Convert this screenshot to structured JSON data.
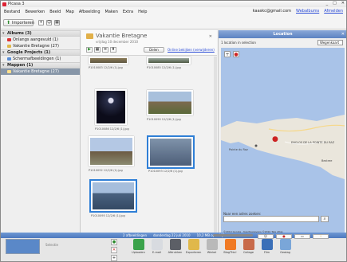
{
  "window": {
    "title": "Picasa 3",
    "controls": [
      "_",
      "□",
      "✕"
    ]
  },
  "menu": [
    "Bestand",
    "Bewerken",
    "Beeld",
    "Map",
    "Afbeelding",
    "Maken",
    "Extra",
    "Help"
  ],
  "user": {
    "email": "kaaskc@gmail.com",
    "links": [
      "Webalbums",
      "Afmelden"
    ]
  },
  "toolbar": {
    "import_label": "Importeren",
    "filter_label": "Filters"
  },
  "search": {
    "placeholder": ""
  },
  "sidebar": {
    "groups": [
      {
        "label": "Albums (3)",
        "items": [
          "Onlangs aangevuld (1)",
          "Vakantie Bretagne (27)"
        ]
      },
      {
        "label": "Google Projects (1)",
        "items": [
          "Schermafbeeldingen (1)"
        ]
      },
      {
        "label": "Mappen (1)",
        "items": [
          "Vakantie Bretagne (27)"
        ]
      }
    ]
  },
  "album": {
    "title": "Vakantie Bretagne",
    "subtitle": "vrijdag 10 december 2010",
    "share_label": "Delen",
    "link_label": "Online bekijken (verwijderen)"
  },
  "thumbs": [
    {
      "caption": "P1010083 12/2/6 (1).jpg",
      "colors": [
        "#8a7a56",
        "#5f5843"
      ]
    },
    {
      "caption": "P1010085 12/2/6 (1).jpg",
      "colors": [
        "#9aa89c",
        "#4f5a44"
      ]
    },
    {
      "caption": "P1010086 12/2/6 (1).jpg",
      "colors": [
        "#0c0c1a",
        "#4a5a8a"
      ]
    },
    {
      "caption": "P1010090 12/2/6 (1).jpg",
      "colors": [
        "#a8c0dc",
        "#7d6a50"
      ]
    },
    {
      "caption": "P1010092 12/2/6 (1).jpg",
      "colors": [
        "#b4c8e4",
        "#6b5a42"
      ]
    },
    {
      "caption": "P1010093 12/2/6 (1).jpg",
      "colors": [
        "#7f93aa",
        "#4d5e78"
      ]
    },
    {
      "caption": "P1010095 12/2/6 (1).jpg",
      "colors": [
        "#a6bedc",
        "#4a6280"
      ]
    }
  ],
  "location": {
    "title": "Location",
    "located_text": "1 location in selection",
    "view_select": "Wegenkaart",
    "map_labels": [
      "Pointe du Raz",
      "ENCLOS DE LA POINTE DU RAZ",
      "Bestree"
    ],
    "copyright": "©2010 Google - Kaartgegevens ©2010 Tele Atlas",
    "address_label": "Naar een adres zoeken:"
  },
  "status": {
    "selected": "2 afbeeldingen",
    "date": "donderdag 22 juli 2010",
    "size": "10,2 MB op schijf"
  },
  "bottom": {
    "selection_label": "Selectie",
    "actions": [
      "Uploaden",
      "E-mail",
      "Afdrukken",
      "Exporteren",
      "Winkel",
      "BlogThis!",
      "Collage",
      "Film",
      "Geotag"
    ]
  },
  "colors": {
    "accent": "#2f7fd6",
    "selected_row": "#8796a8",
    "folder": "#e1b04a"
  }
}
